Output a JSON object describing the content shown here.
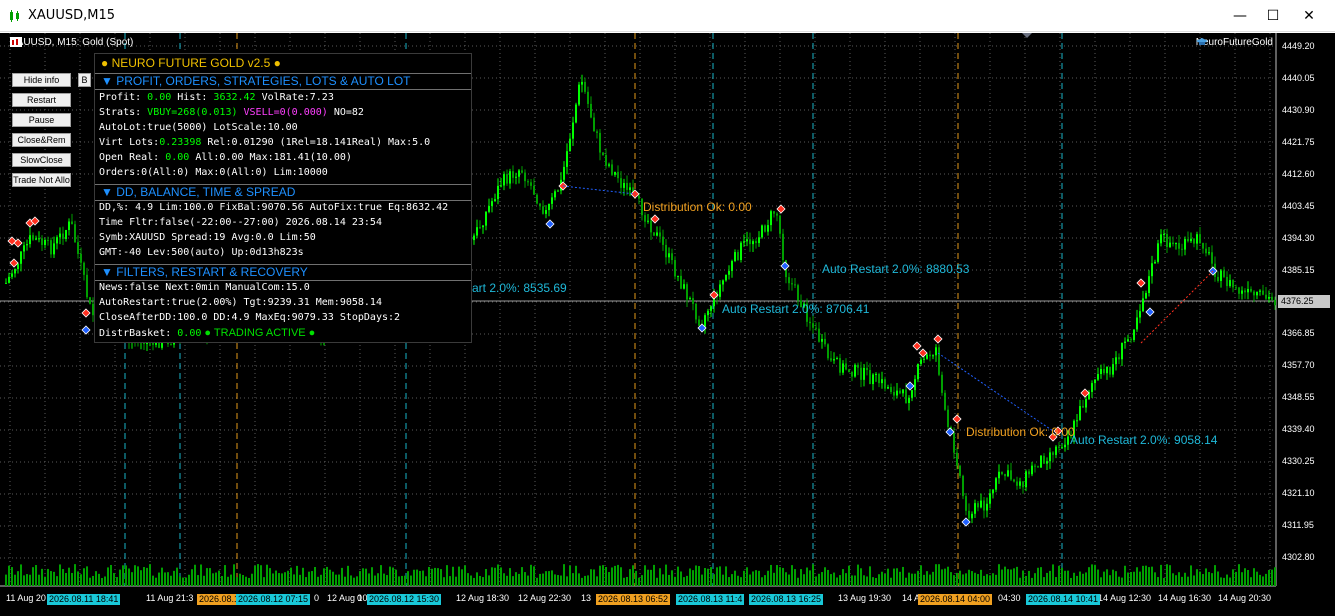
{
  "window": {
    "title": "XAUUSD,M15",
    "minimize": "—",
    "maximize": "☐",
    "close": "✕"
  },
  "chart_header": {
    "symbol_info": "XAUUSD, M15:  Gold (Spot)",
    "brand": "NeuroFutureGold"
  },
  "controls": {
    "hide_info": "Hide info",
    "b": "B",
    "restart": "Restart",
    "pause": "Pause",
    "close_rem": "Close&Rem",
    "slow_close": "SlowClose",
    "trade_not_allo": "Trade Not Allo"
  },
  "panel": {
    "title": "● NEURO FUTURE GOLD v2.5 ●",
    "sec1": "▼ PROFIT, ORDERS, STRATEGIES, LOTS & AUTO LOT",
    "r1a": "Profit: ",
    "r1b": "0.00",
    "r1c": "   Hist: ",
    "r1d": "3632.42",
    "r1e": "   VolRate:7.23",
    "r2a": "Strats: ",
    "r2b": "VBUY=268(0.013)",
    "r2c": "  ",
    "r2d": "VSELL=0(0.000)",
    "r2e": "  NO=82",
    "r3": "AutoLot:true(5000)       LotScale:10.00",
    "r4a": "Virt Lots:",
    "r4b": "0.23398",
    "r4c": "    Rel:0.01290 (1Rel=18.141Real)  Max:5.0",
    "r5a": "Open Real: ",
    "r5b": "0.00",
    "r5c": "    All:0.00 Max:181.41(10.00)",
    "r6": "Orders:0(All:0) Max:0(All:0) Lim:10000",
    "sec2": "▼ DD, BALANCE, TIME & SPREAD",
    "r7": "DD,%: 4.9  Lim:100.0 FixBal:9070.56 AutoFix:true Eq:8632.42",
    "r8": "Time Fltr:false(-22:00--27:00)  2026.08.14 23:54",
    "r9": "Symb:XAUUSD    Spread:19 Avg:0.0 Lim:50",
    "r10": "GMT:-40 Lev:500(auto)    Up:0d13h823s",
    "sec3": "▼ FILTERS, RESTART & RECOVERY",
    "r11": "News:false  Next:0min  ManualCom:15.0",
    "r12": "AutoRestart:true(2.00%)   Tgt:9239.31 Mem:9058.14",
    "r13": "CloseAfterDD:100.0 DD:4.9  MaxEq:9079.33 StopDays:2",
    "r14a": "DistrBasket:  ",
    "r14b": "0.00",
    "r14c": "  ● TRADING ACTIVE ●"
  },
  "annotations": {
    "a1": "art 2.0%: 8535.69",
    "a2": "Distribution Ok: 0.00",
    "a3": "Auto Restart 2.0%: 8880.53",
    "a4": "Auto Restart 2.0%: 8706.41",
    "a5": "Distribution Ok: 0.00",
    "a6": "Auto Restart 2.0%: 9058.14"
  },
  "price_axis": {
    "labels": [
      "4449.20",
      "4440.05",
      "4430.90",
      "4421.75",
      "4412.60",
      "4403.45",
      "4394.30",
      "4385.15",
      "4366.85",
      "4357.70",
      "4348.55",
      "4339.40",
      "4330.25",
      "4321.10",
      "4311.95",
      "4302.80"
    ],
    "current": "4376.25"
  },
  "time_axis": {
    "labels": [
      "11 Aug 20",
      "11 Aug 21:3",
      "12 Aug 10",
      "12 Aug 18:30",
      "12 Aug 22:30",
      "13",
      "13 Aug 19:30",
      "14 A",
      "04:30",
      "14 Aug 12:30",
      "14 Aug 16:30",
      "14 Aug 20:30",
      "0",
      "0"
    ],
    "tags": [
      "2026.08.11 18:41",
      "2026.08.12",
      "2026.08.12 07:15",
      "2026.08.12 15:30",
      "2026.08.13 06:52",
      "2026.08.13 11:4",
      "2026.08.13 16:25",
      "2026.08.14 04:00",
      "2026.08.14 10:41"
    ]
  },
  "colors": {
    "bull": "#00ff00",
    "bear": "#00a000",
    "grid": "#5a5a5a",
    "cyan_line": "#19b4c8",
    "orange_line": "#e59a1a",
    "tag_cyan": "#19c8d8",
    "tag_orange": "#f0a020"
  }
}
